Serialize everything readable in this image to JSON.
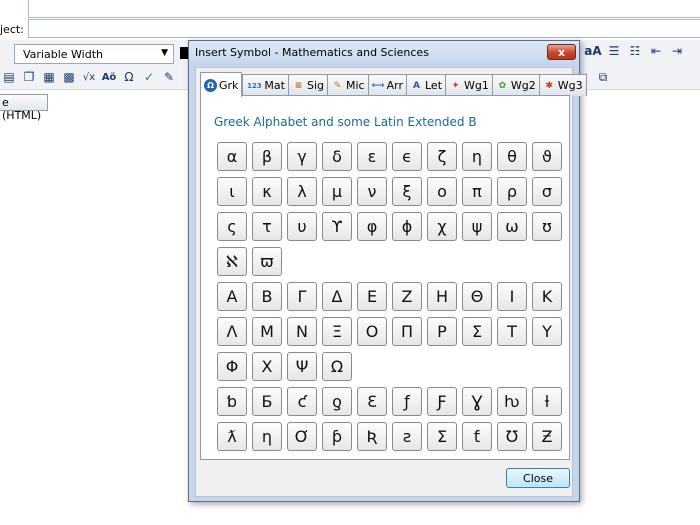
{
  "app": {
    "subject_label": "ject:",
    "font_select_value": "Variable Width",
    "tab_label": "e (HTML)",
    "toolbar_glyphs": [
      "√x",
      "Aö",
      "Ω"
    ]
  },
  "dialog": {
    "title": "Insert Symbol - Mathematics and Sciences",
    "close_x": "x",
    "tabs": [
      {
        "label": "Grk",
        "icon": "omega-circle-icon",
        "glyph": "Ω",
        "color": "#1f64b0"
      },
      {
        "label": "Mat",
        "icon": "numbers-icon",
        "glyph": "123",
        "color": "#2e6fb8"
      },
      {
        "label": "Sig",
        "icon": "abacus-icon",
        "glyph": "≡",
        "color": "#b5651d"
      },
      {
        "label": "Mic",
        "icon": "pencil-icon",
        "glyph": "✎",
        "color": "#c47a1a"
      },
      {
        "label": "Arr",
        "icon": "arrows-icon",
        "glyph": "⟷",
        "color": "#3a76c8"
      },
      {
        "label": "Let",
        "icon": "letter-a-icon",
        "glyph": "A",
        "color": "#2b57a8"
      },
      {
        "label": "Wg1",
        "icon": "wingding-1-icon",
        "glyph": "✦",
        "color": "#c0392b"
      },
      {
        "label": "Wg2",
        "icon": "wingding-2-icon",
        "glyph": "✿",
        "color": "#3aa335"
      },
      {
        "label": "Wg3",
        "icon": "wingding-3-icon",
        "glyph": "✱",
        "color": "#c0392b"
      }
    ],
    "active_tab": "Grk",
    "heading": "Greek Alphabet and some Latin Extended B",
    "symbol_rows": [
      [
        "α",
        "β",
        "γ",
        "δ",
        "ε",
        "ϵ",
        "ζ",
        "η",
        "θ",
        "ϑ"
      ],
      [
        "ι",
        "κ",
        "λ",
        "μ",
        "ν",
        "ξ",
        "ο",
        "π",
        "ρ",
        "σ"
      ],
      [
        "ς",
        "τ",
        "υ",
        "ϒ",
        "φ",
        "ϕ",
        "χ",
        "ψ",
        "ω",
        "ʊ"
      ],
      [
        "ℵ",
        "ϖ"
      ],
      [
        "Α",
        "Β",
        "Γ",
        "Δ",
        "Ε",
        "Ζ",
        "Η",
        "Θ",
        "Ι",
        "Κ"
      ],
      [
        "Λ",
        "Μ",
        "Ν",
        "Ξ",
        "Ο",
        "Π",
        "Ρ",
        "Σ",
        "Τ",
        "Υ"
      ],
      [
        "Φ",
        "Χ",
        "Ψ",
        "Ω"
      ],
      [
        "ƅ",
        "Ƃ",
        "ƈ",
        "ƍ",
        "Ɛ",
        "ƒ",
        "Ƒ",
        "Ɣ",
        "ƕ",
        "ƚ"
      ],
      [
        "ƛ",
        "ƞ",
        "Ơ",
        "ƥ",
        "Ʀ",
        "ƨ",
        "Ʃ",
        "ƭ",
        "Ʊ",
        "Ƶ"
      ]
    ],
    "close_button": "Close"
  }
}
